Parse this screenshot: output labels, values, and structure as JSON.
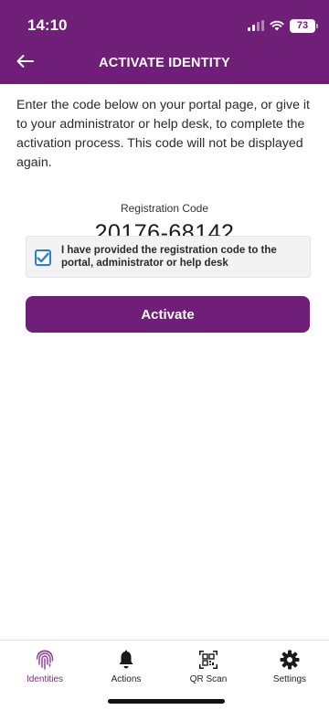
{
  "status_bar": {
    "time": "14:10",
    "battery": "73"
  },
  "header": {
    "title": "ACTIVATE IDENTITY",
    "back_icon": "arrow-left-icon"
  },
  "main": {
    "instructions": "Enter the code below on your portal page, or give it to your administrator or help desk, to complete the activation process. This code will not be displayed again.",
    "registration_label": "Registration Code",
    "registration_code": "20176-68142",
    "confirm_checkbox": {
      "label": "I have provided the registration code to the portal, administrator or help desk",
      "checked": true
    },
    "activate_label": "Activate"
  },
  "tabbar": {
    "items": [
      {
        "label": "Identities",
        "icon": "fingerprint-icon",
        "active": true
      },
      {
        "label": "Actions",
        "icon": "bell-icon",
        "active": false
      },
      {
        "label": "QR Scan",
        "icon": "qr-code-icon",
        "active": false
      },
      {
        "label": "Settings",
        "icon": "gear-icon",
        "active": false
      }
    ]
  },
  "colors": {
    "brand": "#701F78",
    "checkbox": "#2b7fd4",
    "active_tab": "#7a2b82"
  }
}
